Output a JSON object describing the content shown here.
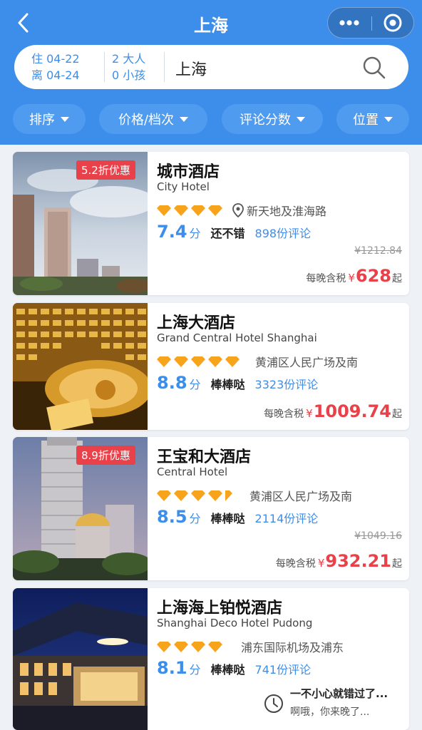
{
  "nav": {
    "title": "上海"
  },
  "search": {
    "checkin": "住 04-22",
    "checkout": "离 04-24",
    "adults": "2 大人",
    "children": "0 小孩",
    "city": "上海"
  },
  "filters": [
    {
      "label": "排序"
    },
    {
      "label": "价格/档次"
    },
    {
      "label": "评论分数"
    },
    {
      "label": "位置"
    }
  ],
  "hotels": [
    {
      "badge": "5.2折优惠",
      "name": "城市酒店",
      "english_name": "City Hotel",
      "diamonds": 4,
      "location": "新天地及淮海路",
      "score": "7.4",
      "score_unit": "分",
      "rating_text": "还不错",
      "reviews": "898份评论",
      "original_price": "¥1212.84",
      "price_prefix": "每晚含税",
      "currency": "¥",
      "price": "628",
      "price_suffix": "起"
    },
    {
      "name": "上海大酒店",
      "english_name": "Grand Central Hotel Shanghai",
      "diamonds": 5,
      "location": "黄浦区人民广场及南",
      "score": "8.8",
      "score_unit": "分",
      "rating_text": "棒棒哒",
      "reviews": "3323份评论",
      "price_prefix": "每晚含税",
      "currency": "¥",
      "price": "1009.74",
      "price_suffix": "起"
    },
    {
      "badge": "8.9折优惠",
      "name": "王宝和大酒店",
      "english_name": "Central Hotel",
      "diamonds": 4.5,
      "location": "黄浦区人民广场及南",
      "score": "8.5",
      "score_unit": "分",
      "rating_text": "棒棒哒",
      "reviews": "2114份评论",
      "original_price": "¥1049.16",
      "price_prefix": "每晚含税",
      "currency": "¥",
      "price": "932.21",
      "price_suffix": "起"
    },
    {
      "name": "上海海上铂悦酒店",
      "english_name": "Shanghai Deco Hotel Pudong",
      "diamonds": 4,
      "location": "浦东国际机场及浦东",
      "score": "8.1",
      "score_unit": "分",
      "rating_text": "棒棒哒",
      "reviews": "741份评论"
    }
  ],
  "toast": {
    "line1": "一不小心就错过了...",
    "line2": "啊哦，你来晚了..."
  },
  "colors": {
    "primary": "#3d8eea",
    "diamond": "#f7a31c",
    "price": "#e8414a",
    "badge": "#e8414a"
  },
  "icons": {
    "back": "back-arrow-icon",
    "more": "more-dots-icon",
    "close": "close-mini-program-icon",
    "search": "search-icon",
    "location": "location-pin-icon",
    "clock": "clock-icon",
    "diamond": "diamond-icon"
  }
}
